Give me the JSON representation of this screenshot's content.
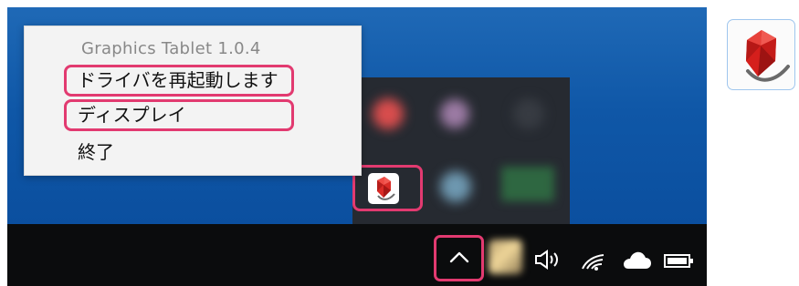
{
  "menu": {
    "title": "Graphics Tablet 1.0.4",
    "restart_label": "ドライバを再起動します",
    "display_label": "ディスプレイ",
    "exit_label": "終了"
  },
  "highlight_color": "#e23a70",
  "desktop_color": "#1161ad",
  "taskbar_color": "#0b0c0d",
  "icons": {
    "tablet_tray": "graphics-tablet-icon",
    "overflow": "chevron-up-icon",
    "volume": "speaker-icon",
    "network": "wifi-icon",
    "cloud": "cloud-icon",
    "battery": "battery-icon"
  }
}
